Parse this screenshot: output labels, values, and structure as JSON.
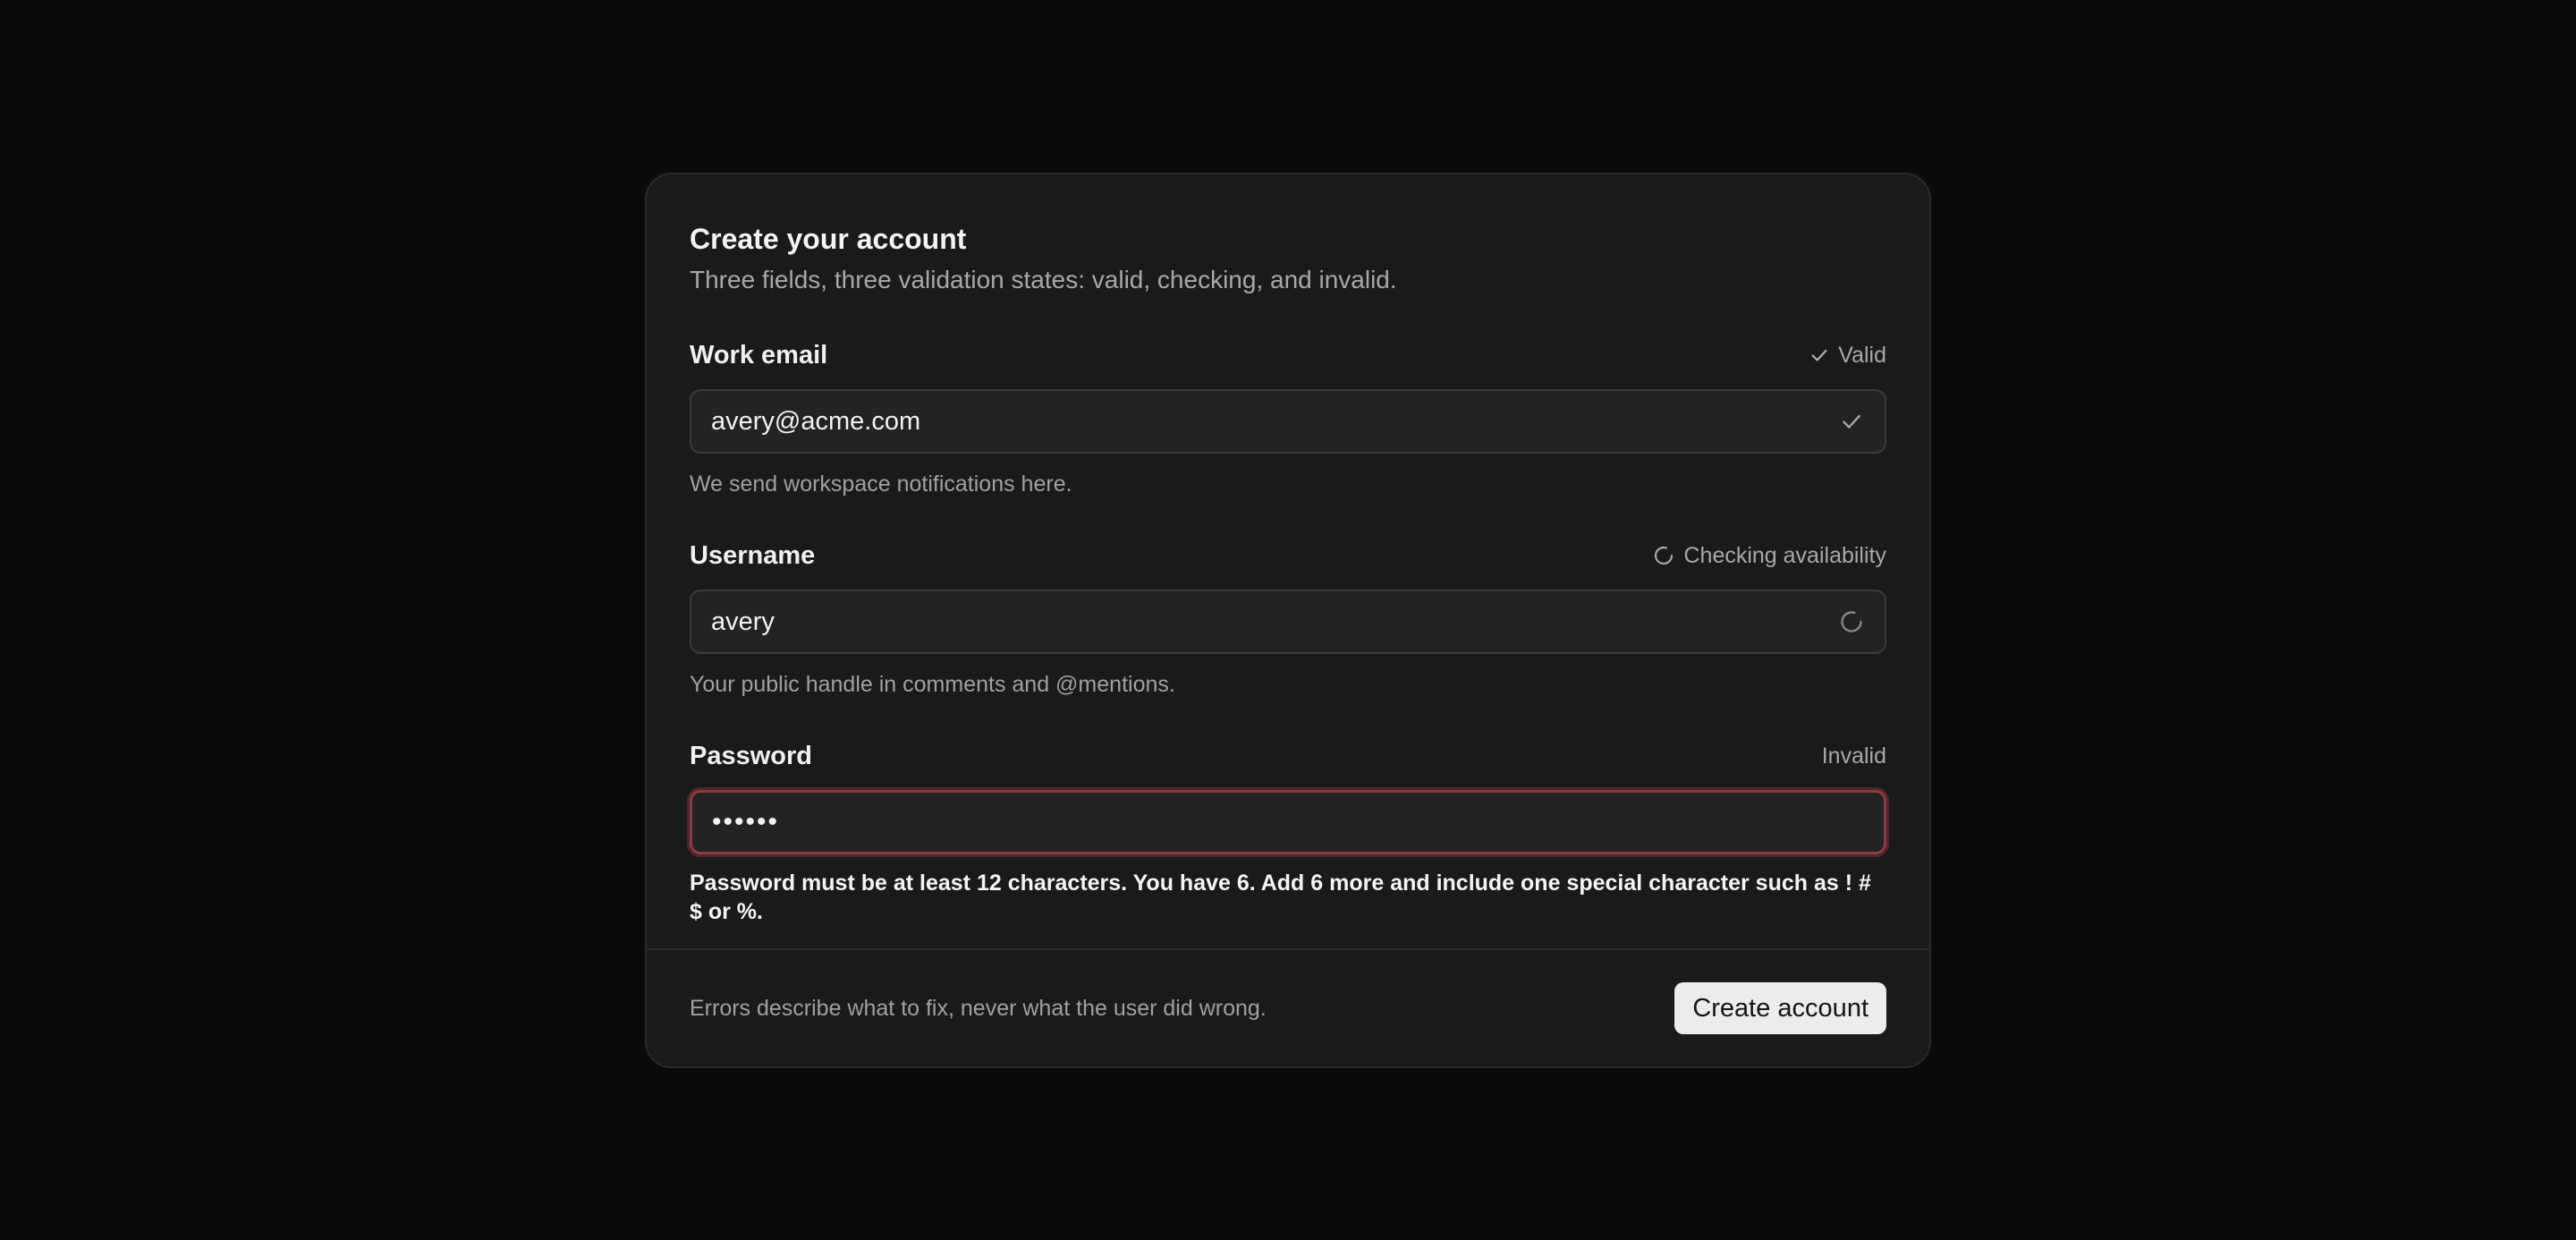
{
  "header": {
    "title": "Create your account",
    "subtitle": "Three fields, three validation states: valid, checking, and invalid."
  },
  "fields": {
    "email": {
      "label": "Work email",
      "status": "Valid",
      "status_icon": "check-icon",
      "value": "avery@acme.com",
      "input_icon": "check-icon",
      "hint": "We send workspace notifications here."
    },
    "username": {
      "label": "Username",
      "status": "Checking availability",
      "status_icon": "spinner-icon",
      "value": "avery",
      "input_icon": "spinner-icon",
      "hint": "Your public handle in comments and @mentions."
    },
    "password": {
      "label": "Password",
      "status": "Invalid",
      "value": "••••••",
      "error": "Password must be at least 12 characters. You have 6. Add 6 more and include one special character such as ! # $ or %."
    }
  },
  "footer": {
    "note": "Errors describe what to fix, never what the user did wrong.",
    "submit_label": "Create account"
  },
  "colors": {
    "background": "#0b0b0b",
    "card": "#1a1a1a",
    "input": "#232323",
    "invalid_border": "#8c3a40",
    "button": "#ececec"
  }
}
